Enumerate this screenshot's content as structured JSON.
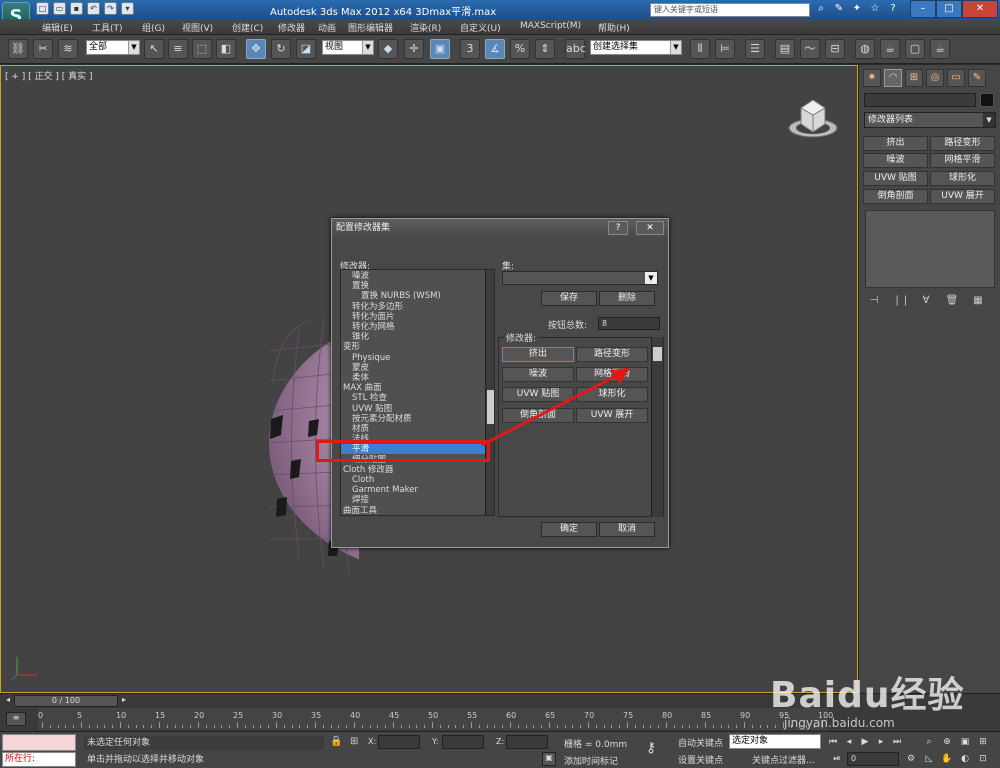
{
  "titlebar": {
    "app_title": "Autodesk 3ds Max  2012 x64      3Dmax平滑.max",
    "search_placeholder": "键入关键字或短语",
    "logo": "S"
  },
  "menu": [
    "编辑(E)",
    "工具(T)",
    "组(G)",
    "视图(V)",
    "创建(C)",
    "修改器",
    "动画",
    "图形编辑器",
    "渲染(R)",
    "自定义(U)",
    "MAXScript(M)",
    "帮助(H)"
  ],
  "toolbar": {
    "selection_filter": "全部",
    "ref_coord": "视图",
    "named_selection": "创建选择集",
    "snap_3": "3",
    "percent": "%"
  },
  "viewport": {
    "label": "[ + ] [ 正交 ] [ 真实 ]"
  },
  "command_panel": {
    "modifier_list": "修改器列表",
    "buttons": [
      "挤出",
      "路径变形",
      "噪波",
      "网格平滑",
      "UVW 贴图",
      "球形化",
      "倒角剖面",
      "UVW 展开"
    ]
  },
  "dialog": {
    "title": "配置修改器集",
    "help": "?",
    "close": "✕",
    "modifiers_label": "修改器:",
    "tree": [
      {
        "text": "噪波",
        "indent": 1,
        "selected": false
      },
      {
        "text": "置换",
        "indent": 1,
        "selected": false
      },
      {
        "text": "置换 NURBS (WSM)",
        "indent": 2,
        "selected": false
      },
      {
        "text": "转化为多边形",
        "indent": 1,
        "selected": false
      },
      {
        "text": "转化为面片",
        "indent": 1,
        "selected": false
      },
      {
        "text": "转化为网格",
        "indent": 1,
        "selected": false
      },
      {
        "text": "锥化",
        "indent": 1,
        "selected": false
      },
      {
        "text": "变形",
        "indent": 0,
        "selected": false
      },
      {
        "text": "Physique",
        "indent": 1,
        "selected": false
      },
      {
        "text": "蒙皮",
        "indent": 1,
        "selected": false
      },
      {
        "text": "柔体",
        "indent": 1,
        "selected": false
      },
      {
        "text": "MAX 曲面",
        "indent": 0,
        "selected": false
      },
      {
        "text": "STL 检查",
        "indent": 1,
        "selected": false
      },
      {
        "text": "UVW 贴图",
        "indent": 1,
        "selected": false
      },
      {
        "text": "按元素分配材质",
        "indent": 1,
        "selected": false
      },
      {
        "text": "材质",
        "indent": 1,
        "selected": false
      },
      {
        "text": "法线",
        "indent": 1,
        "selected": false
      },
      {
        "text": "平滑",
        "indent": 1,
        "selected": true
      },
      {
        "text": "细分贴图",
        "indent": 1,
        "selected": false
      },
      {
        "text": "Cloth 修改器",
        "indent": 0,
        "selected": false
      },
      {
        "text": "Cloth",
        "indent": 1,
        "selected": false
      },
      {
        "text": "Garment Maker",
        "indent": 1,
        "selected": false
      },
      {
        "text": "焊接",
        "indent": 1,
        "selected": false
      },
      {
        "text": "曲面工具",
        "indent": 0,
        "selected": false
      }
    ],
    "sets_label": "集:",
    "save": "保存",
    "delete": "删除",
    "total_label": "按钮总数:",
    "total_value": "8",
    "group_label": "修改器:",
    "modifier_buttons": [
      "挤出",
      "路径变形",
      "噪波",
      "网格平滑",
      "UVW 贴图",
      "球形化",
      "倒角剖面",
      "UVW 展开"
    ],
    "ok": "确定",
    "cancel": "取消"
  },
  "timeline": {
    "frame_counter": "0 / 100",
    "ticks": [
      0,
      5,
      10,
      15,
      20,
      25,
      30,
      35,
      40,
      45,
      50,
      55,
      60,
      65,
      70,
      75,
      80,
      85,
      90,
      95,
      100
    ]
  },
  "statusbar": {
    "running": "所在行:",
    "selection_status": "未选定任何对象",
    "prompt": "单击并拖动以选择并移动对象",
    "x_label": "X:",
    "y_label": "Y:",
    "z_label": "Z:",
    "grid": "栅格 = 0.0mm",
    "add_time_tag": "添加时间标记",
    "auto_key": "自动关键点",
    "set_key": "设置关键点",
    "selected_object": "选定对象",
    "key_filters": "关键点过滤器...",
    "current_frame": "0"
  },
  "watermark": {
    "text": "Baidu经验",
    "url": "jingyan.baidu.com"
  }
}
